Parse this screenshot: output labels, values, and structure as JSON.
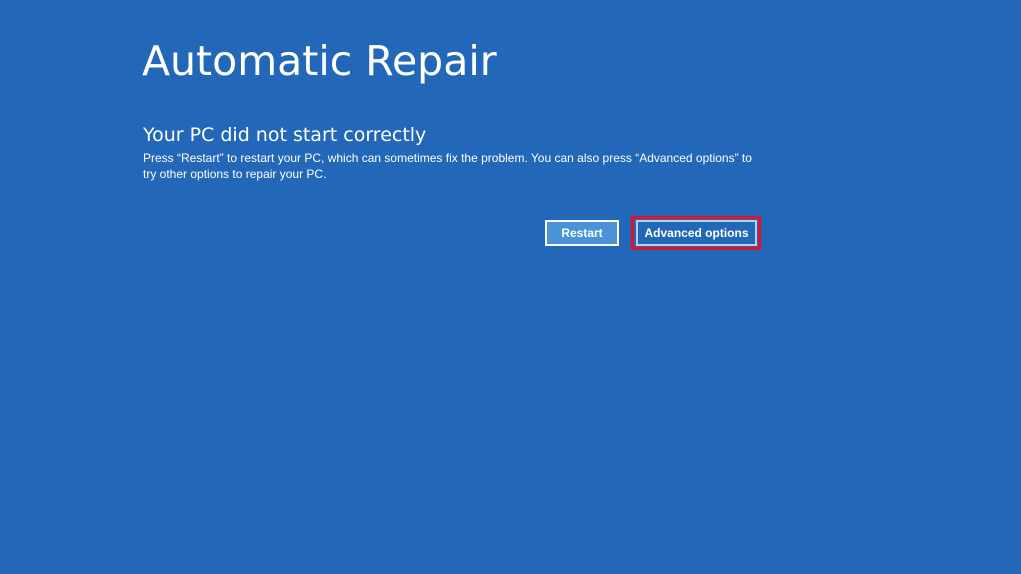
{
  "page": {
    "title": "Automatic Repair",
    "subtitle": "Your PC did not start correctly",
    "message": "Press “Restart” to restart your PC, which can sometimes fix the problem. You can also press “Advanced options” to try other options to repair your PC."
  },
  "buttons": {
    "restart_label": "Restart",
    "advanced_label": "Advanced options"
  },
  "colors": {
    "background": "#2267b8",
    "restart_button": "#4a93d6",
    "highlight": "#e0122e",
    "text": "#ffffff"
  }
}
